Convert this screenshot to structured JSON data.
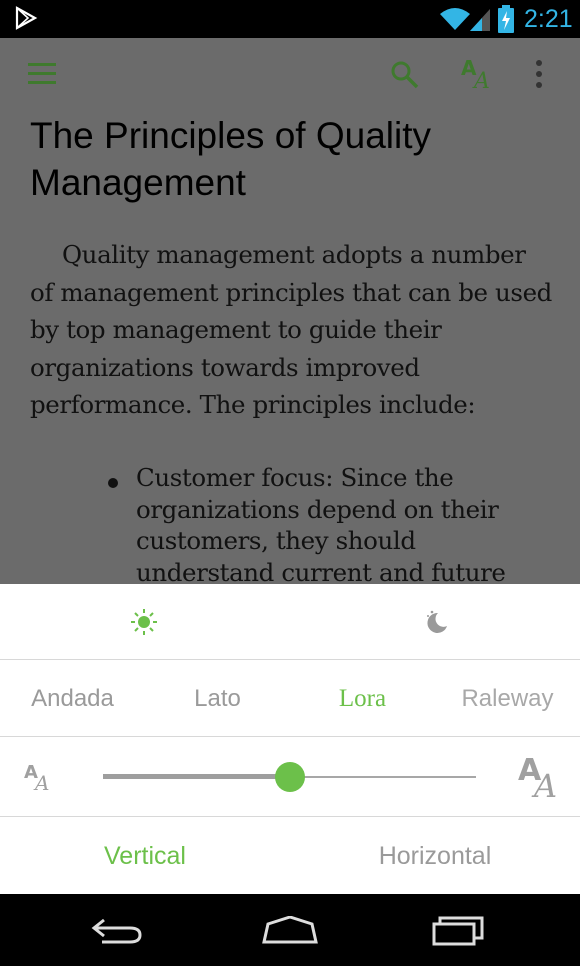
{
  "status_bar": {
    "time": "2:21",
    "icons": [
      "play-store-icon",
      "wifi-icon",
      "signal-icon",
      "battery-charging-icon"
    ]
  },
  "toolbar": {
    "icons": [
      "menu-icon",
      "search-icon",
      "font-settings-icon",
      "overflow-menu-icon"
    ],
    "accent_color": "#4caf50"
  },
  "article": {
    "title": "The Principles of Quality Management",
    "paragraph": "Quality management adopts a number of management principles that can be used by top management to guide their organizations towards improved performance. The principles include:",
    "bullets": [
      "Customer focus: Since the organizations depend on their customers, they should understand current and future"
    ]
  },
  "settings": {
    "themes": [
      {
        "name": "day",
        "icon": "sun-icon",
        "selected": true
      },
      {
        "name": "night",
        "icon": "moon-icon",
        "selected": false
      }
    ],
    "fonts": [
      {
        "label": "Andada",
        "selected": false
      },
      {
        "label": "Lato",
        "selected": false
      },
      {
        "label": "Lora",
        "selected": true
      },
      {
        "label": "Raleway",
        "selected": false
      }
    ],
    "font_size": {
      "small_icon": "font-size-small-icon",
      "large_icon": "font-size-large-icon",
      "level": 0.5
    },
    "orientation": [
      {
        "label": "Vertical",
        "selected": true
      },
      {
        "label": "Horizontal",
        "selected": false
      }
    ],
    "accent_color": "#6cc04a"
  },
  "nav_bar": {
    "icons": [
      "back-icon",
      "home-icon",
      "recents-icon"
    ]
  }
}
